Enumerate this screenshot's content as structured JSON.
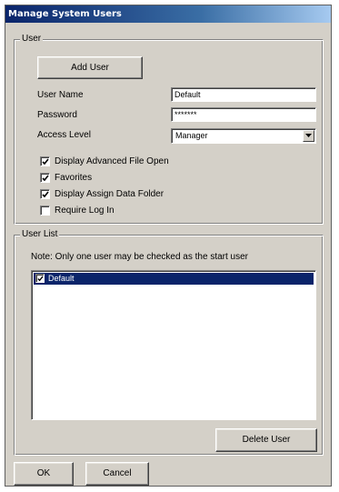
{
  "window": {
    "title": "Manage System Users"
  },
  "user_group": {
    "legend": "User",
    "add_user_label": "Add User",
    "user_name_label": "User Name",
    "user_name_value": "Default",
    "password_label": "Password",
    "password_value": "*******",
    "access_level_label": "Access Level",
    "access_level_value": "Manager",
    "options": [
      {
        "label": "Display Advanced File Open",
        "checked": true
      },
      {
        "label": "Favorites",
        "checked": true
      },
      {
        "label": "Display Assign Data Folder",
        "checked": true
      },
      {
        "label": "Require Log In",
        "checked": false
      }
    ]
  },
  "user_list_group": {
    "legend": "User List",
    "note": "Note: Only one user may be checked as the start user",
    "items": [
      {
        "label": "Default",
        "checked": true,
        "selected": true
      }
    ],
    "delete_user_label": "Delete User"
  },
  "footer": {
    "ok_label": "OK",
    "cancel_label": "Cancel"
  },
  "colors": {
    "selection": "#0a246a",
    "dialog_face": "#d4d0c8"
  },
  "icons": {
    "checkmark": "check-icon",
    "dropdown": "chevron-down-icon"
  }
}
